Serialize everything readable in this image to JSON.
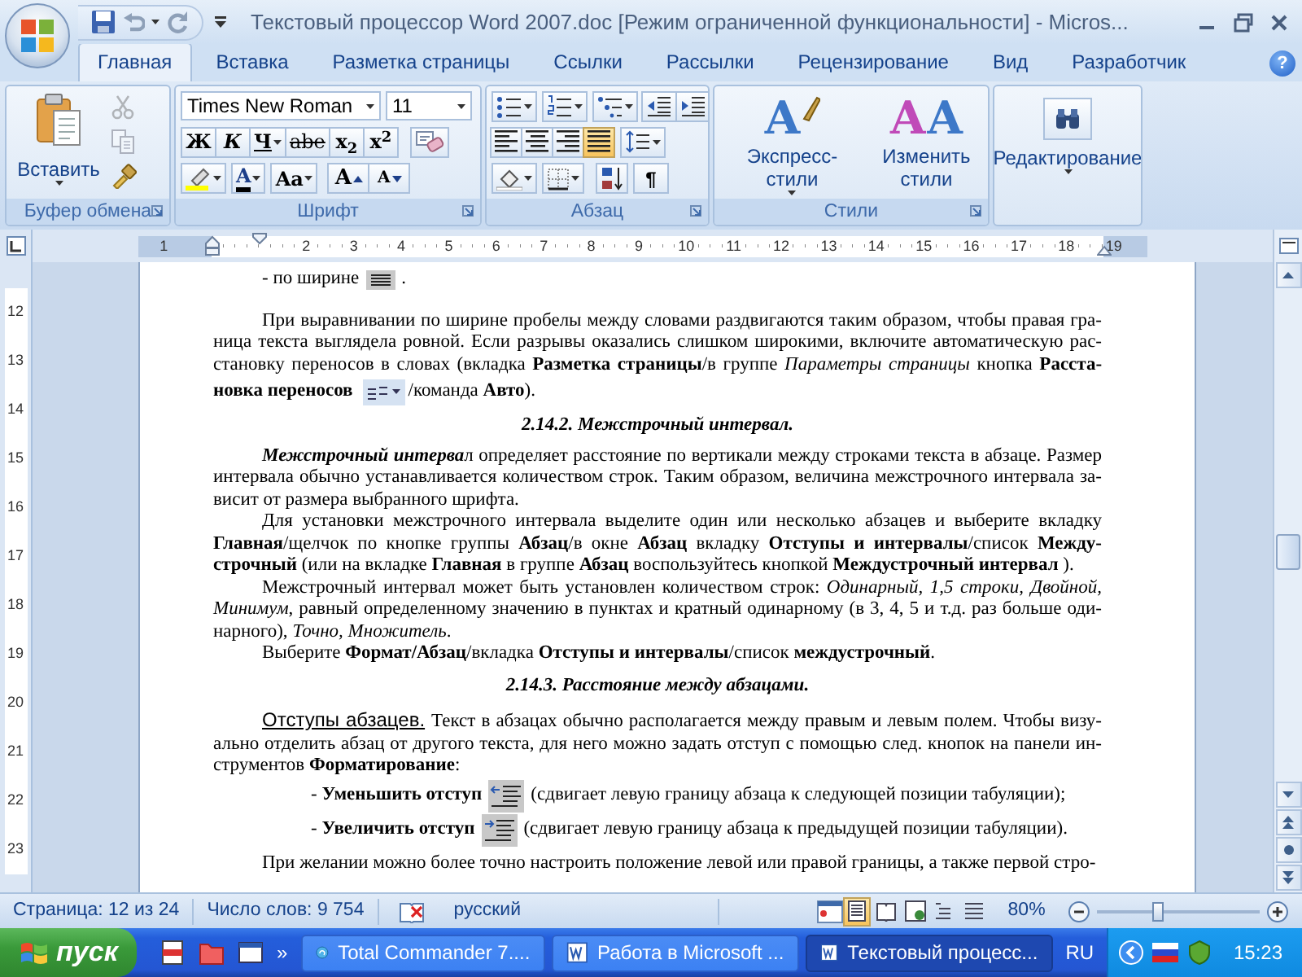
{
  "window": {
    "title": "Текстовый процессор Word 2007.doc [Режим ограниченной функциональности] - Micros..."
  },
  "tabs": [
    {
      "label": "Главная",
      "selected": true
    },
    {
      "label": "Вставка",
      "selected": false
    },
    {
      "label": "Разметка страницы",
      "selected": false
    },
    {
      "label": "Ссылки",
      "selected": false
    },
    {
      "label": "Рассылки",
      "selected": false
    },
    {
      "label": "Рецензирование",
      "selected": false
    },
    {
      "label": "Вид",
      "selected": false
    },
    {
      "label": "Разработчик",
      "selected": false
    }
  ],
  "help_label": "?",
  "ribbon": {
    "clipboard": {
      "title": "Буфер обмена",
      "paste_label": "Вставить",
      "tools": [
        {
          "kind": "cut",
          "disabled": true
        },
        {
          "kind": "copy",
          "disabled": true
        },
        {
          "kind": "painter",
          "disabled": false
        }
      ]
    },
    "font": {
      "title": "Шрифт",
      "font_name": "Times New Roman",
      "font_size": "11",
      "format_buttons": [
        {
          "kind": "bold",
          "label": "Ж"
        },
        {
          "kind": "italic",
          "label": "К"
        },
        {
          "kind": "underline",
          "label": "Ч"
        },
        {
          "kind": "strike",
          "label": "abe"
        },
        {
          "kind": "subscript",
          "label": "x$_{2}$"
        },
        {
          "kind": "superscript",
          "label": "x$^{2}$"
        }
      ],
      "color_label": "A",
      "case_label": "Aa",
      "grow_label": "A",
      "shrink_label": "A"
    },
    "paragraph": {
      "title": "Абзац",
      "align_buttons": [
        {
          "kind": "left",
          "selected": false
        },
        {
          "kind": "center",
          "selected": false
        },
        {
          "kind": "right",
          "selected": false
        },
        {
          "kind": "justify",
          "selected": true
        }
      ],
      "pilcrow": "¶"
    },
    "styles": {
      "title": "Стили",
      "quick_glyphs": [
        "A"
      ],
      "quick_label": "Экспресс-стили",
      "change_glyphs": [
        "A",
        "A"
      ],
      "change_label": "Изменить стили"
    },
    "editing": {
      "label": "Редактирование"
    }
  },
  "ruler": {
    "labels": [
      "1",
      "2",
      "3",
      "4",
      "5",
      "6",
      "7",
      "8",
      "9",
      "10",
      "11",
      "12",
      "13",
      "14",
      "15",
      "16",
      "17",
      "18",
      "19"
    ]
  },
  "vertical_ruler": {
    "labels": [
      "12",
      "13",
      "14",
      "15",
      "16",
      "17",
      "18",
      "19",
      "20",
      "21",
      "22",
      "23"
    ]
  },
  "document": {
    "blocks": [
      {
        "kind": "justify-item",
        "before": "- по ширине",
        "after": "."
      },
      {
        "kind": "paragraph",
        "lines": [
          "При выравнивании по ширине пробелы между словами раздвигаются таким образом, чтобы правая гра-",
          "ница текста выглядела ровной. Если разрывы оказались слишком широкими, включите автоматическую рас-",
          "становку переносов в словах (вкладка **Разметка страницы**/в группе *Параметры страницы* кнопка **Расста-**"
        ],
        "tail": {
          "before": "**новка переносов**",
          "after": "/команда **Авто**)."
        }
      },
      {
        "kind": "heading",
        "text": "2.14.2. Межстрочный интервал."
      },
      {
        "kind": "paragraph",
        "lead": {
          "kind": "emphasis",
          "text": "Межстрочный интерва"
        },
        "lines": [
          "л определяет расстояние по вертикали между строками текста в абзаце. Размер",
          "интервала обычно устанавливается количеством строк. Таким образом, величина межстрочного интервала за-",
          "висит от размера выбранного шрифта."
        ]
      },
      {
        "kind": "paragraph",
        "lines": [
          "Для установки межстрочного интервала выделите один или несколько абзацев и выберите вкладку",
          "**Главная**/щелчок по кнопке группы **Абзац**/в окне **Абзац** вкладку **Отступы и интервалы**/список **Между-**",
          "**строчный** (или на вкладке **Главная** в группе **Абзац** воспользуйтесь кнопкой **Междустрочный интервал** )."
        ]
      },
      {
        "kind": "paragraph",
        "lines": [
          "Межстрочный интервал может быть установлен количеством строк: *Одинарный, 1,5 строки, Двойной,*",
          "*Минимум*, равный определенному значению в пунктах и кратный одинарному (в 3, 4, 5 и т.д. раз больше оди-",
          "нарного), *Точно, Множитель*."
        ]
      },
      {
        "kind": "paragraph",
        "lines": [
          "Выберите **Формат/Абзац**/вкладка **Отступы и интервалы**/список **междустрочный**."
        ]
      },
      {
        "kind": "heading",
        "text": "2.14.3. Расстояние между абзацами."
      },
      {
        "kind": "paragraph",
        "lead": {
          "kind": "underlined",
          "text": "Отступы абзацев."
        },
        "lines": [
          "Текст в абзацах обычно располагается между правым и левым полем. Чтобы визу-",
          "ально отделить абзац от другого текста, для него можно задать отступ с помощью след. кнопок на панели ин-",
          "струментов **Форматирование**:"
        ]
      },
      {
        "kind": "outdent-item",
        "before": "- **Уменьшить отступ**",
        "after": "(сдвигает левую границу абзаца к следующей позиции табуляции);"
      },
      {
        "kind": "indent-item",
        "before": "- **Увеличить отступ**",
        "after": "(сдвигает левую границу абзаца к предыдущей позиции табуляции)."
      },
      {
        "kind": "paragraph",
        "lines": [
          "При желании можно более точно настроить положение левой или правой границы, а также первой стро-"
        ]
      }
    ]
  },
  "status_bar": {
    "page": "Страница: 12 из 24",
    "words": "Число слов: 9 754",
    "language": "русский",
    "views": [
      {
        "selected": true
      },
      {
        "selected": false
      },
      {
        "selected": false
      },
      {
        "selected": false
      },
      {
        "selected": false
      }
    ],
    "zoom": "80%",
    "zoom_slider": {
      "level": 0.37
    }
  },
  "taskbar": {
    "start": "пуск",
    "more": "»",
    "tasks": [
      {
        "label": "Total Commander 7....",
        "selected": false
      },
      {
        "label": "Работа в Microsoft ...",
        "selected": false
      },
      {
        "label": "Текстовый процесс...",
        "selected": true
      }
    ],
    "language": "RU",
    "clock": "15:23"
  }
}
